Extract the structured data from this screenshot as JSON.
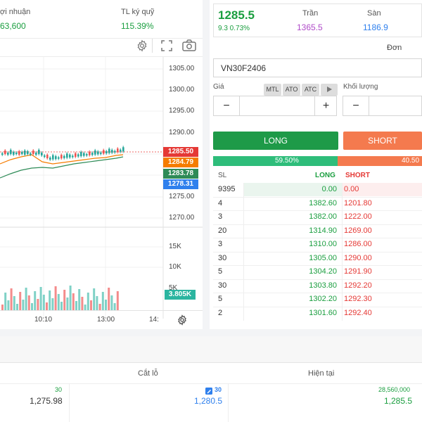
{
  "summary": {
    "profit_label": "ợi nhuận",
    "profit_value": "63,600",
    "margin_label": "TL ký quỹ",
    "margin_value": "115.39%"
  },
  "chart": {
    "price_ticks": [
      "1305.00",
      "1300.00",
      "1295.00",
      "1290.00",
      "1280.00",
      "1275.00",
      "1270.00"
    ],
    "price_tags": [
      {
        "value": "1285.50",
        "color": "#e53935"
      },
      {
        "value": "1284.79",
        "color": "#f57c00"
      },
      {
        "value": "1283.78",
        "color": "#2e8b57"
      },
      {
        "value": "1278.31",
        "color": "#2f80ed"
      }
    ],
    "volume_ticks": [
      "15K",
      "10K",
      "5K"
    ],
    "volume_tag": "3.805K",
    "time_labels": [
      "10:10",
      "13:00",
      "14:"
    ]
  },
  "quote": {
    "last_price": "1285.5",
    "change": "9.3 0.73%",
    "ceiling_label": "Trần",
    "ceiling_value": "1365.5",
    "floor_label": "Sàn",
    "floor_value": "1186.9",
    "order_label": "Đơn"
  },
  "order_form": {
    "symbol": "VN30F2406",
    "price_label": "Giá",
    "qty_label": "Khối lượng",
    "chips": [
      "MTL",
      "ATO",
      "ATC"
    ],
    "minus": "−",
    "plus": "+",
    "long_label": "LONG",
    "short_label": "SHORT",
    "long_pct": "59.50%",
    "short_pct": "40.50"
  },
  "orderbook": {
    "headers": {
      "sl": "SL",
      "long": "LONG",
      "short": "SHORT"
    },
    "rows": [
      {
        "sl": "9395",
        "long": "0.00",
        "short": "0.00"
      },
      {
        "sl": "4",
        "long": "1382.60",
        "short": "1201.80"
      },
      {
        "sl": "3",
        "long": "1382.00",
        "short": "1222.00"
      },
      {
        "sl": "20",
        "long": "1314.90",
        "short": "1269.00"
      },
      {
        "sl": "3",
        "long": "1310.00",
        "short": "1286.00"
      },
      {
        "sl": "30",
        "long": "1305.00",
        "short": "1290.00"
      },
      {
        "sl": "5",
        "long": "1304.20",
        "short": "1291.90"
      },
      {
        "sl": "30",
        "long": "1303.80",
        "short": "1292.20"
      },
      {
        "sl": "5",
        "long": "1302.20",
        "short": "1292.30"
      },
      {
        "sl": "2",
        "long": "1301.60",
        "short": "1292.40"
      }
    ]
  },
  "positions": {
    "stop_loss_label": "Cắt lỗ",
    "current_label": "Hiện tại",
    "col1_qty": "30",
    "col1_price": "1,275.98",
    "col2_qty": "30",
    "col2_price": "1,280.5",
    "col3_value": "28,560,000",
    "col3_price": "1,285.5"
  }
}
